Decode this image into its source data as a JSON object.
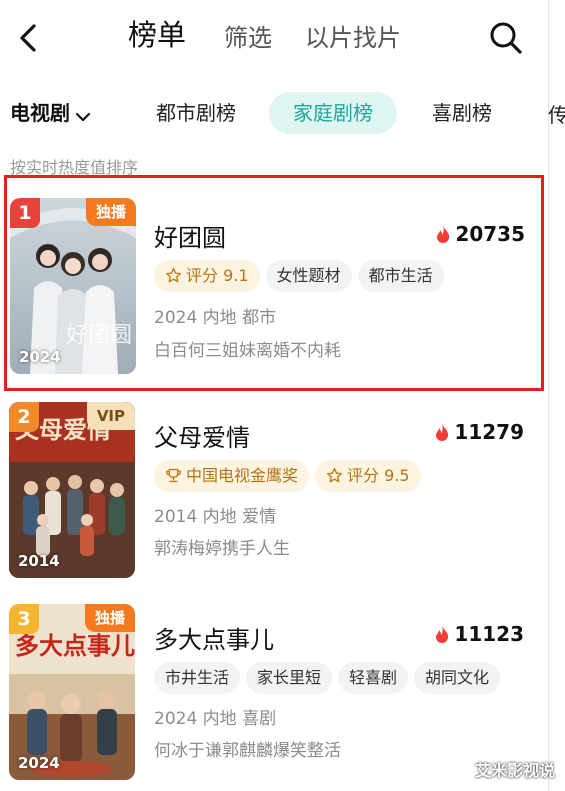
{
  "nav": {
    "tabs": [
      {
        "label": "榜单",
        "active": true
      },
      {
        "label": "筛选",
        "active": false
      },
      {
        "label": "以片找片",
        "active": false
      }
    ]
  },
  "category": {
    "dropdown_label": "电视剧",
    "tabs": [
      {
        "label": "都市剧榜",
        "active": false
      },
      {
        "label": "家庭剧榜",
        "active": true
      },
      {
        "label": "喜剧榜",
        "active": false
      },
      {
        "label": "传",
        "active": false
      }
    ]
  },
  "subtitle": "按实时热度值排序",
  "items": [
    {
      "rank": "1",
      "rank_color": "#e8423b",
      "badge": "独播",
      "badge_type": "exclusive",
      "year_badge": "2024",
      "title": "好团圆",
      "heat": "20735",
      "tags": [
        {
          "label": "评分 9.1",
          "type": "rating"
        },
        {
          "label": "女性题材",
          "type": "plain"
        },
        {
          "label": "都市生活",
          "type": "plain"
        }
      ],
      "meta": "2024 内地 都市",
      "desc": "白百何三姐妹离婚不内耗",
      "highlighted": true
    },
    {
      "rank": "2",
      "rank_color": "#f18a2b",
      "badge": "VIP",
      "badge_type": "vip",
      "year_badge": "2014",
      "title": "父母爱情",
      "heat": "11279",
      "tags": [
        {
          "label": "中国电视金鹰奖",
          "type": "award"
        },
        {
          "label": "评分 9.5",
          "type": "rating"
        }
      ],
      "meta": "2014 内地 爱情",
      "desc": "郭涛梅婷携手人生",
      "highlighted": false
    },
    {
      "rank": "3",
      "rank_color": "#f5b52e",
      "badge": "独播",
      "badge_type": "exclusive",
      "year_badge": "2024",
      "title": "多大点事儿",
      "heat": "11123",
      "tags": [
        {
          "label": "市井生活",
          "type": "plain"
        },
        {
          "label": "家长里短",
          "type": "plain"
        },
        {
          "label": "轻喜剧",
          "type": "plain"
        },
        {
          "label": "胡同文化",
          "type": "plain"
        }
      ],
      "meta": "2024 内地 喜剧",
      "desc": "何冰于谦郭麒麟爆笑整活",
      "highlighted": false
    }
  ],
  "watermark": "艾米影视说",
  "icons": {
    "back": "chevron-left-icon",
    "search": "search-icon",
    "dropdown": "chevron-down-icon",
    "heat": "flame-icon",
    "rating": "star-icon",
    "award": "trophy-icon"
  },
  "colors": {
    "accent": "#1aa99b",
    "accent_bg": "#dff5f2",
    "flame": "#ef3e35",
    "highlight_border": "#e0211b",
    "gold_text": "#b57416",
    "gold_bg": "#fdf3e1"
  }
}
